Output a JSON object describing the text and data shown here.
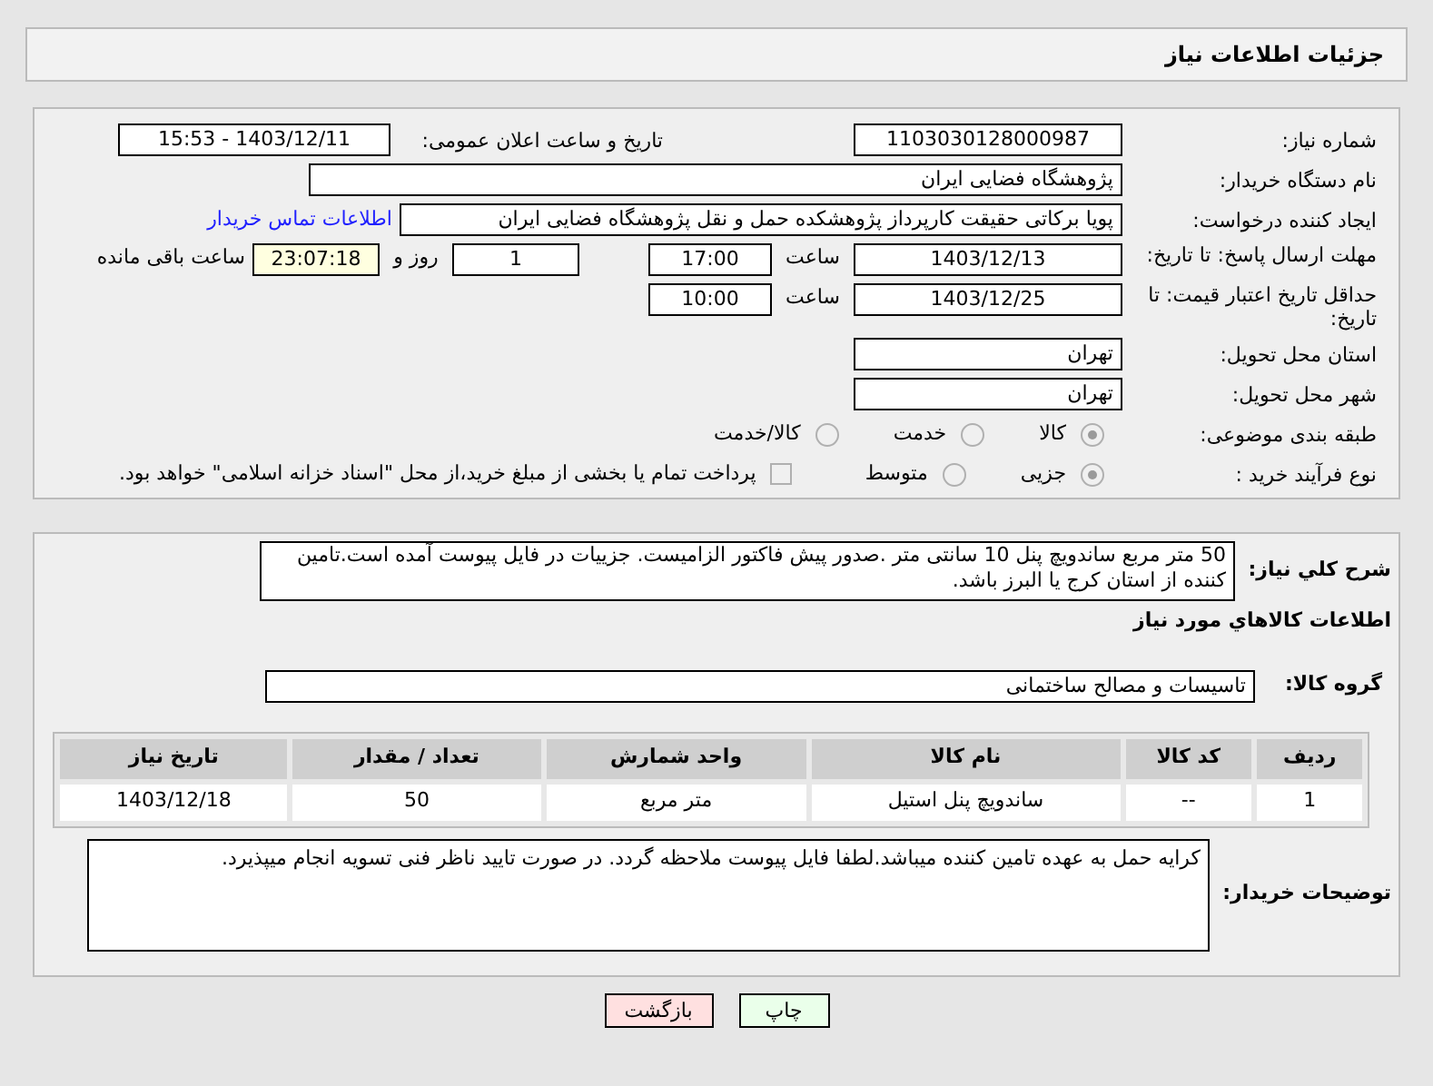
{
  "header": {
    "title": "جزئیات اطلاعات نیاز"
  },
  "need_number": {
    "label": "شماره نیاز:",
    "value": "1103030128000987"
  },
  "announce": {
    "label": "تاریخ و ساعت اعلان عمومی:",
    "value": "1403/12/11 - 15:53"
  },
  "buyer_org": {
    "label": "نام دستگاه خریدار:",
    "value": "پژوهشگاه فضایی ایران"
  },
  "requester": {
    "label": "ایجاد کننده درخواست:",
    "value": "پویا برکاتی حقیقت کارپرداز پژوهشکده حمل و نقل پژوهشگاه فضایی ایران",
    "link": "اطلاعات تماس خریدار"
  },
  "deadline": {
    "label": "مهلت ارسال پاسخ: تا تاریخ:",
    "date": "1403/12/13",
    "time_label": "ساعت",
    "time": "17:00",
    "days": "1",
    "days_label": "روز و",
    "remaining": "23:07:18",
    "remaining_label": "ساعت باقی مانده"
  },
  "validity": {
    "label": "حداقل تاریخ اعتبار قیمت: تا تاریخ:",
    "date": "1403/12/25",
    "time_label": "ساعت",
    "time": "10:00"
  },
  "province": {
    "label": "استان محل تحویل:",
    "value": "تهران"
  },
  "city": {
    "label": "شهر محل تحویل:",
    "value": "تهران"
  },
  "category": {
    "label": "طبقه بندی موضوعی:",
    "options": [
      {
        "label": "کالا",
        "selected": true
      },
      {
        "label": "خدمت",
        "selected": false
      },
      {
        "label": "کالا/خدمت",
        "selected": false
      }
    ]
  },
  "process": {
    "label": "نوع فرآیند خرید :",
    "options": [
      {
        "label": "جزیی",
        "selected": true
      },
      {
        "label": "متوسط",
        "selected": false
      }
    ],
    "checkbox": {
      "label": "پرداخت تمام یا بخشی از مبلغ خرید،از محل \"اسناد خزانه اسلامی\" خواهد بود.",
      "checked": false
    }
  },
  "description": {
    "label": "شرح کلي نياز:",
    "value": "50 متر مربع ساندویچ پنل 10 سانتی متر .صدور پیش فاکتور الزامیست. جزییات در فایل پیوست آمده است.تامین کننده از استان کرج یا البرز باشد."
  },
  "goods_heading": "اطلاعات کالاهاي مورد نياز",
  "goods_group": {
    "label": "گروه کالا:",
    "value": "تاسیسات و مصالح ساختمانی"
  },
  "table": {
    "columns": [
      "ردیف",
      "کد کالا",
      "نام کالا",
      "واحد شمارش",
      "تعداد / مقدار",
      "تاریخ نیاز"
    ],
    "rows": [
      [
        "1",
        "--",
        "ساندویچ پنل استیل",
        "متر مربع",
        "50",
        "1403/12/18"
      ]
    ]
  },
  "buyer_notes": {
    "label": "توضیحات خریدار:",
    "value": "کرایه حمل به عهده تامین کننده میباشد.لطفا فایل پیوست ملاحظه گردد. در صورت تایید ناظر فنی تسویه انجام میپذیرد."
  },
  "buttons": [
    {
      "label": "چاپ",
      "kind": "print"
    },
    {
      "label": "بازگشت",
      "kind": "back"
    }
  ]
}
